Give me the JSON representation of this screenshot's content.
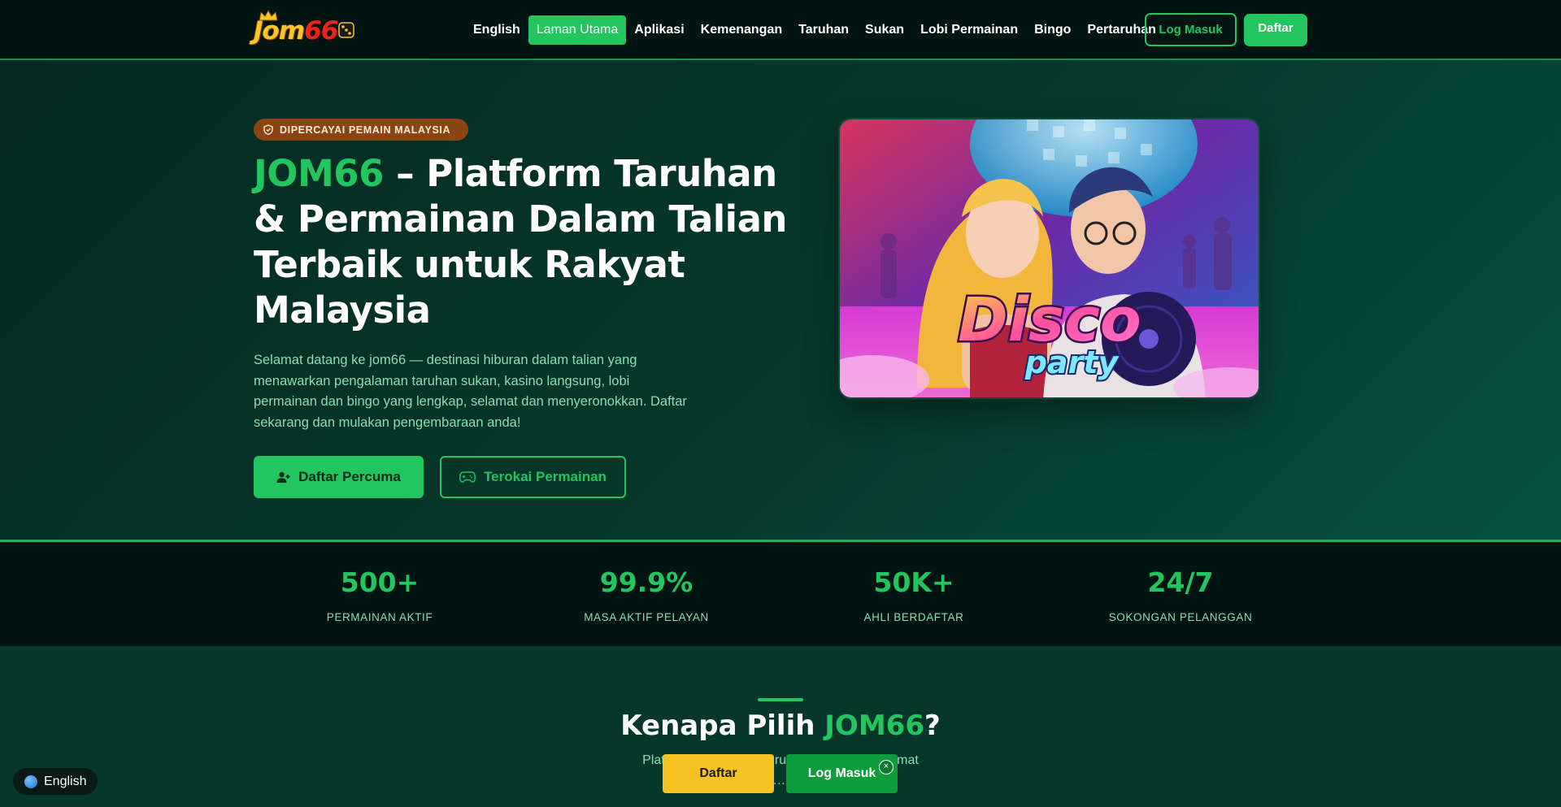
{
  "header": {
    "logo_text_main": "Jom",
    "logo_text_num": "66",
    "nav": [
      {
        "label": "English"
      },
      {
        "label": "Laman Utama"
      },
      {
        "label": "Aplikasi"
      },
      {
        "label": "Kemenangan"
      },
      {
        "label": "Taruhan"
      },
      {
        "label": "Sukan"
      },
      {
        "label": "Lobi Permainan"
      },
      {
        "label": "Bingo"
      },
      {
        "label": "Pertaruhan"
      }
    ],
    "active_index": 1,
    "login_label": "Log Masuk",
    "register_label": "Daftar"
  },
  "hero": {
    "badge": "DIPERCAYAI PEMAIN MALAYSIA",
    "title_brand": "JOM66",
    "title_rest": " – Platform Taruhan & Permainan Dalam Talian Terbaik untuk Rakyat Malaysia",
    "description": "Selamat datang ke jom66 — destinasi hiburan dalam talian yang menawarkan pengalaman taruhan sukan, kasino langsung, lobi permainan dan bingo yang lengkap, selamat dan menyeronokkan. Daftar sekarang dan mulakan pengembaraan anda!",
    "cta_primary": "Daftar Percuma",
    "cta_secondary": "Terokai Permainan",
    "game_image_text_1": "Disco",
    "game_image_text_2": "party"
  },
  "stats": [
    {
      "value": "500+",
      "label": "PERMAINAN AKTIF"
    },
    {
      "value": "99.9%",
      "label": "MASA AKTIF PELAYAN"
    },
    {
      "value": "50K+",
      "label": "AHLI BERDAFTAR"
    },
    {
      "value": "24/7",
      "label": "SOKONGAN PELANGGAN"
    }
  ],
  "why": {
    "title_pre": "Kenapa Pilih ",
    "title_brand": "JOM66",
    "title_post": "?",
    "desc_line_1": "Platform jom66 direk…ru…a — pantas, selamat",
    "desc_line_2": "da…                        ja."
  },
  "floating": {
    "language": "English",
    "daftar": "Daftar",
    "login": "Log Masuk",
    "close": "×"
  },
  "colors": {
    "accent": "#22c55e",
    "header_bg": "#031512",
    "badge_bg": "#8a4512",
    "yellow_cta": "#f6c324"
  }
}
